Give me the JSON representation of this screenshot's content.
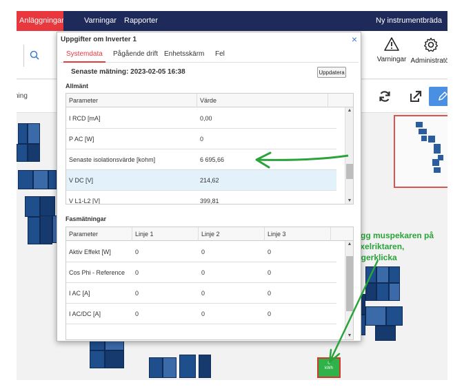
{
  "nav": {
    "active": "Anläggningar",
    "items": [
      "Varningar",
      "Rapporter"
    ],
    "right": "Ny instrumentbräda"
  },
  "toolbar": {
    "warnings_label": "Varningar",
    "warnings_icon": "warning-triangle-icon",
    "admin_label": "Administratör",
    "admin_icon": "gear-icon",
    "search_icon": "search-icon"
  },
  "subbar": {
    "left_text": "ning"
  },
  "dialog": {
    "title": "Uppgifter om Inverter 1",
    "tabs": [
      "Systemdata",
      "Pågående drift",
      "Enhetsskärm",
      "Fel"
    ],
    "active_tab": 0,
    "latest_measurement": "Senaste mätning: 2023-02-05 16:38",
    "update_button": "Uppdatera",
    "section_general": "Allmänt",
    "general_table": {
      "headers": [
        "Parameter",
        "Värde"
      ],
      "rows": [
        {
          "param": "I RCD [mA]",
          "value": "0,00"
        },
        {
          "param": "P AC [W]",
          "value": "0"
        },
        {
          "param": "Senaste isolationsvärde [kohm]",
          "value": "6 695,66"
        },
        {
          "param": "V DC [V]",
          "value": "214,62"
        },
        {
          "param": "V L1-L2 [V]",
          "value": "399,81"
        }
      ]
    },
    "section_phase": "Fasmätningar",
    "phase_table": {
      "headers": [
        "Parameter",
        "Linje 1",
        "Linje 2",
        "Linje 3"
      ],
      "rows": [
        {
          "param": "Aktiv Effekt [W]",
          "l1": "0",
          "l2": "0",
          "l3": "0"
        },
        {
          "param": "Cos Phi - Reference",
          "l1": "0",
          "l2": "0",
          "l3": "0"
        },
        {
          "param": "I AC [A]",
          "l1": "0",
          "l2": "0",
          "l3": "0"
        },
        {
          "param": "I AC/DC [A]",
          "l1": "0",
          "l2": "0",
          "l3": "0"
        }
      ]
    }
  },
  "annotation": {
    "lines": [
      "Lägg muspekaren på",
      "växelriktaren,",
      "högerklicka"
    ],
    "color": "#2aa33a"
  },
  "inverter": {
    "label_top": "0",
    "label_mid": "",
    "label_bottom": "kWh"
  }
}
